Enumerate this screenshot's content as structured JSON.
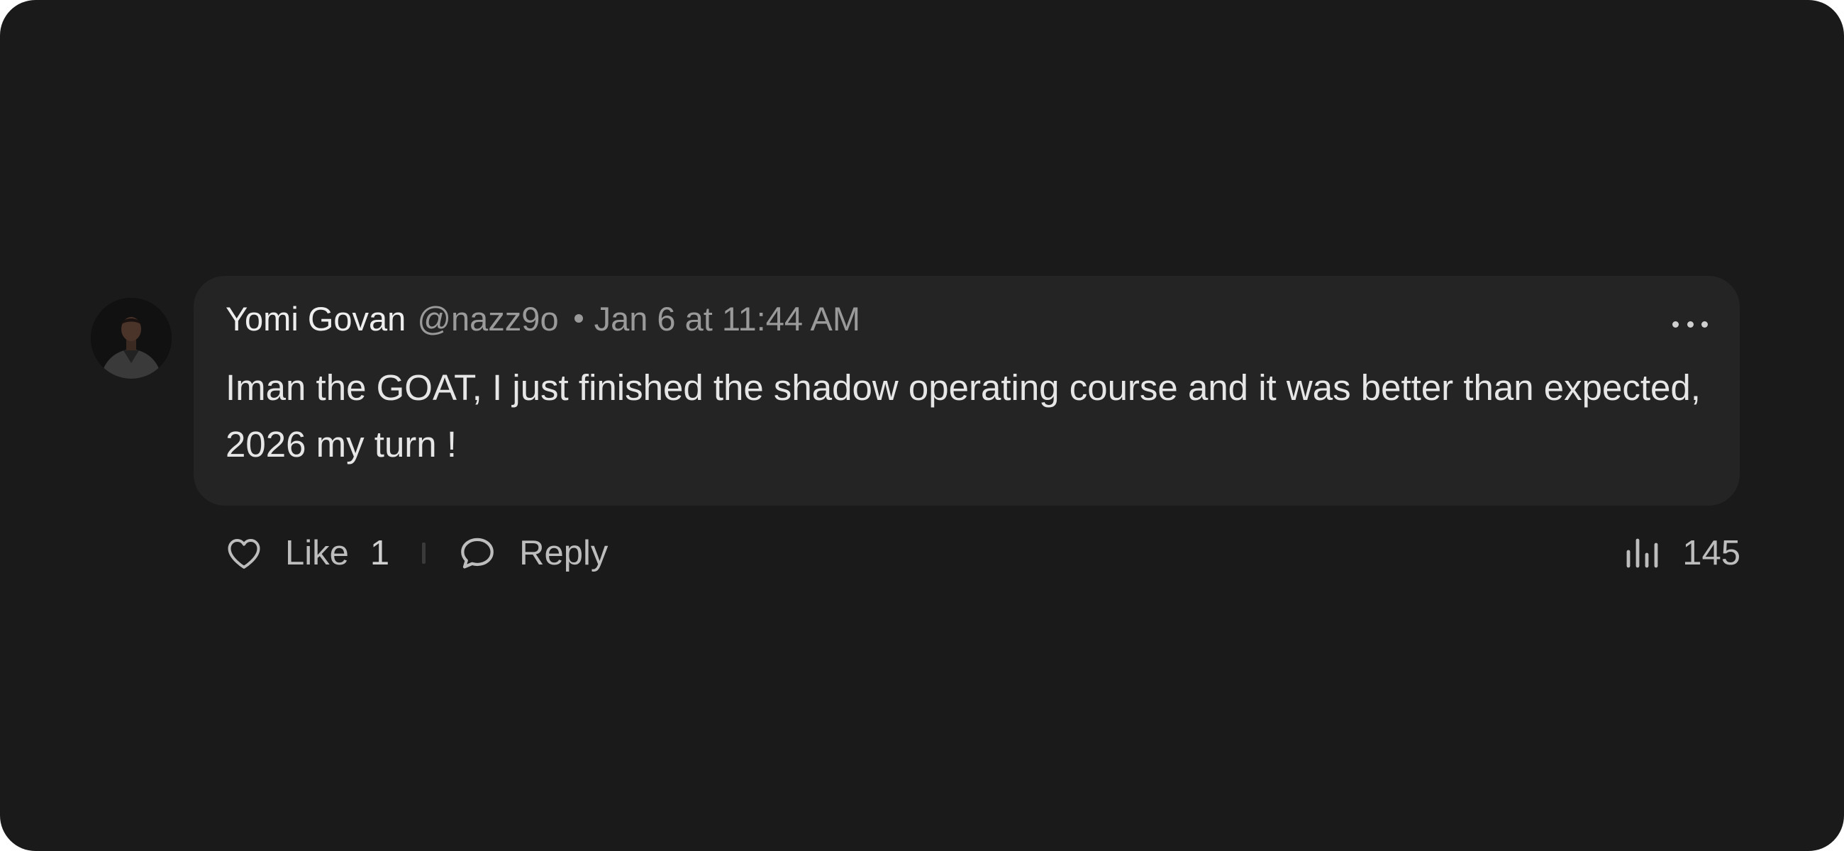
{
  "comment": {
    "author_name": "Yomi Govan",
    "handle": "@nazz9o",
    "timestamp": "Jan 6 at 11:44 AM",
    "text": "Iman the GOAT, I just finished the shadow operating course and it was better than expected, 2026 my turn !"
  },
  "actions": {
    "like_label": "Like",
    "like_count": "1",
    "reply_label": "Reply",
    "views_count": "145"
  },
  "icons": {
    "more": "more-horizontal-icon",
    "like": "heart-icon",
    "reply": "speech-bubble-icon",
    "views": "bar-chart-icon"
  },
  "colors": {
    "background": "#1a1a1a",
    "bubble": "#242424",
    "primary_text": "#e6e6e6",
    "secondary_text": "#9a9a9a"
  }
}
